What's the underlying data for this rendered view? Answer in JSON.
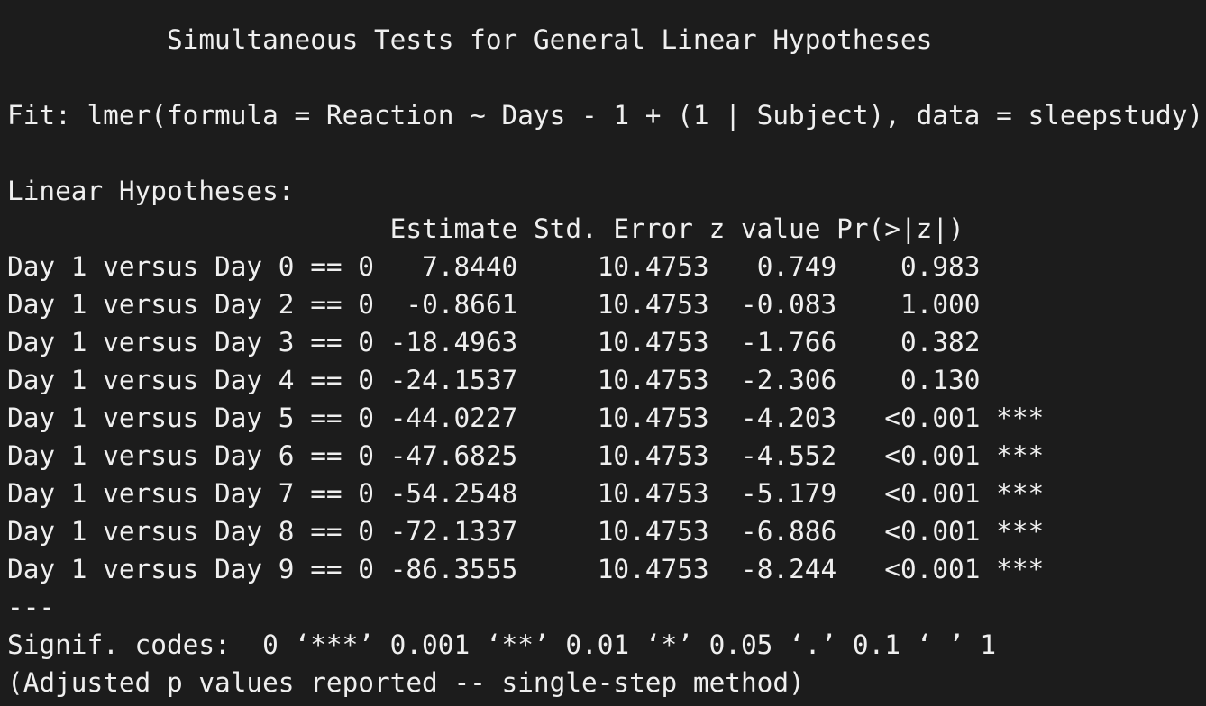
{
  "title": "Simultaneous Tests for General Linear Hypotheses",
  "fit": "Fit: lmer(formula = Reaction ~ Days - 1 + (1 | Subject), data = sleepstudy)",
  "section_label": "Linear Hypotheses:",
  "table": {
    "headers": [
      "Estimate",
      "Std. Error",
      "z value",
      "Pr(>|z|)"
    ],
    "rows": [
      {
        "label": "Day 1 versus Day 0 == 0",
        "estimate": "7.8440",
        "std_error": "10.4753",
        "z_value": "0.749",
        "p_value": "0.983",
        "signif": ""
      },
      {
        "label": "Day 1 versus Day 2 == 0",
        "estimate": "-0.8661",
        "std_error": "10.4753",
        "z_value": "-0.083",
        "p_value": "1.000",
        "signif": ""
      },
      {
        "label": "Day 1 versus Day 3 == 0",
        "estimate": "-18.4963",
        "std_error": "10.4753",
        "z_value": "-1.766",
        "p_value": "0.382",
        "signif": ""
      },
      {
        "label": "Day 1 versus Day 4 == 0",
        "estimate": "-24.1537",
        "std_error": "10.4753",
        "z_value": "-2.306",
        "p_value": "0.130",
        "signif": ""
      },
      {
        "label": "Day 1 versus Day 5 == 0",
        "estimate": "-44.0227",
        "std_error": "10.4753",
        "z_value": "-4.203",
        "p_value": "<0.001",
        "signif": "***"
      },
      {
        "label": "Day 1 versus Day 6 == 0",
        "estimate": "-47.6825",
        "std_error": "10.4753",
        "z_value": "-4.552",
        "p_value": "<0.001",
        "signif": "***"
      },
      {
        "label": "Day 1 versus Day 7 == 0",
        "estimate": "-54.2548",
        "std_error": "10.4753",
        "z_value": "-5.179",
        "p_value": "<0.001",
        "signif": "***"
      },
      {
        "label": "Day 1 versus Day 8 == 0",
        "estimate": "-72.1337",
        "std_error": "10.4753",
        "z_value": "-6.886",
        "p_value": "<0.001",
        "signif": "***"
      },
      {
        "label": "Day 1 versus Day 9 == 0",
        "estimate": "-86.3555",
        "std_error": "10.4753",
        "z_value": "-8.244",
        "p_value": "<0.001",
        "signif": "***"
      }
    ]
  },
  "separator": "---",
  "signif_codes": "Signif. codes:  0 ‘***’ 0.001 ‘**’ 0.01 ‘*’ 0.05 ‘.’ 0.1 ‘ ’ 1",
  "footnote": "(Adjusted p values reported -- single-step method)",
  "colors": {
    "background": "#1c1c1c",
    "text": "#efefef"
  }
}
